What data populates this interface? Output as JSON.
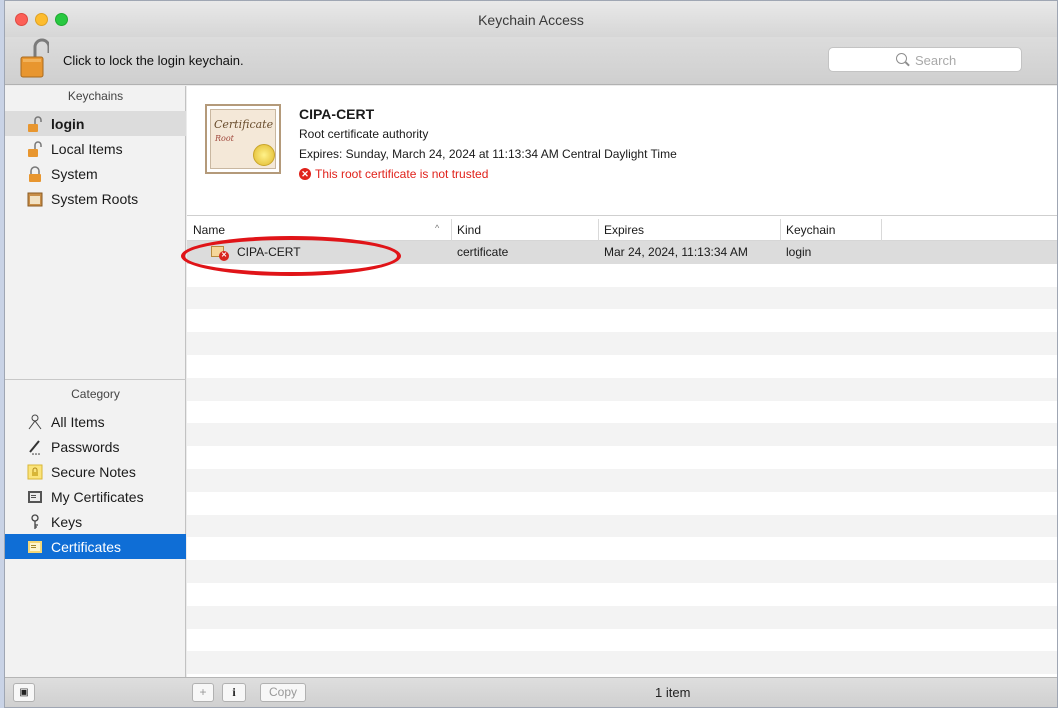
{
  "window": {
    "title": "Keychain Access"
  },
  "toolbar": {
    "lock_text": "Click to lock the login keychain.",
    "search_placeholder": "Search"
  },
  "sidebar": {
    "keychains_header": "Keychains",
    "keychains": [
      {
        "label": "login",
        "icon": "unlocked-padlock-icon"
      },
      {
        "label": "Local Items",
        "icon": "unlocked-padlock-icon"
      },
      {
        "label": "System",
        "icon": "locked-padlock-icon"
      },
      {
        "label": "System Roots",
        "icon": "cabinet-icon"
      }
    ],
    "category_header": "Category",
    "categories": [
      {
        "label": "All Items",
        "icon": "people-icon"
      },
      {
        "label": "Passwords",
        "icon": "pen-icon"
      },
      {
        "label": "Secure Notes",
        "icon": "note-icon"
      },
      {
        "label": "My Certificates",
        "icon": "certificate-icon"
      },
      {
        "label": "Keys",
        "icon": "key-icon"
      },
      {
        "label": "Certificates",
        "icon": "certificate-icon"
      }
    ]
  },
  "info": {
    "name": "CIPA-CERT",
    "subtitle": "Root certificate authority",
    "expires": "Expires: Sunday, March 24, 2024 at 11:13:34 AM Central Daylight Time",
    "warning": "This root certificate is not trusted",
    "image_text_1": "Certificate",
    "image_text_2": "Root"
  },
  "table": {
    "columns": [
      "Name",
      "Kind",
      "Expires",
      "Keychain"
    ],
    "rows": [
      {
        "name": "CIPA-CERT",
        "kind": "certificate",
        "expires": "Mar 24, 2024, 11:13:34 AM",
        "keychain": "login"
      }
    ]
  },
  "bottom": {
    "add": "+",
    "info": "i",
    "copy": "Copy",
    "count": "1 item"
  },
  "colors": {
    "selection": "#0f6ed6",
    "warning": "#e0221b",
    "annotation": "#e01418"
  }
}
